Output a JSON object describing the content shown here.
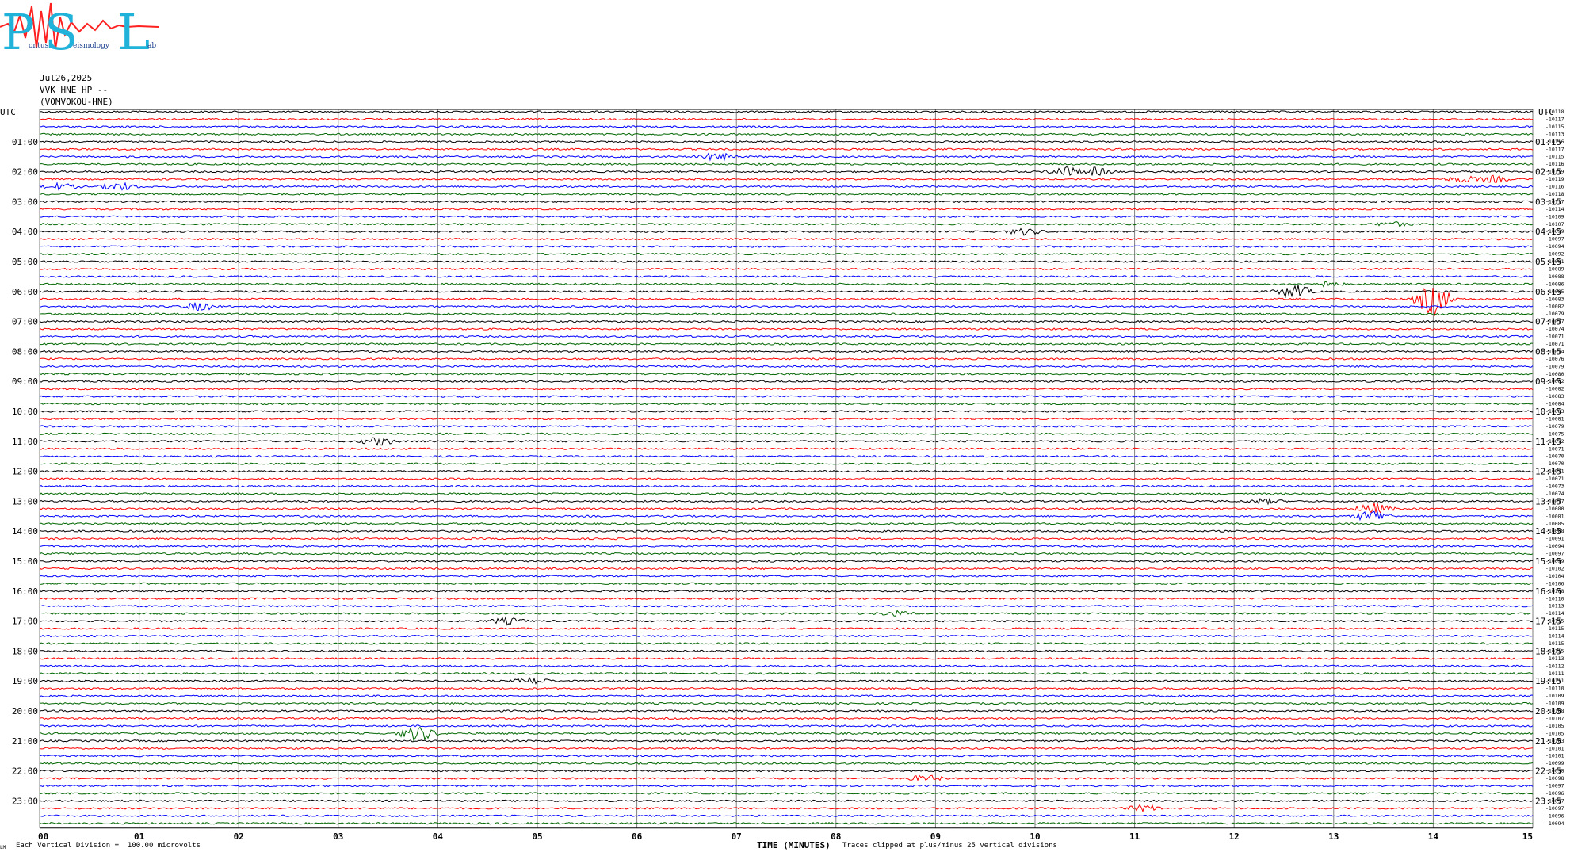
{
  "header": {
    "logo_letters": [
      "P",
      "S",
      "L"
    ],
    "logo_words": [
      "Pontus",
      "Seismology",
      "Lab"
    ],
    "date": "Jul26,2025",
    "station": "VVK HNE HP --",
    "channel": "(VOMVOKOU-HNE)"
  },
  "colors": {
    "trace_cycle": [
      "#000000",
      "#ff0000",
      "#0000ff",
      "#006600"
    ],
    "grid": "#808080",
    "logo_blue": "#20b2d8",
    "logo_red": "#ff2020"
  },
  "footer": {
    "xlabel": "TIME (MINUTES)",
    "clip_note": "Traces clipped at plus/minus 25 vertical divisions",
    "vertical_division": "Each Vertical Division =  100.00 microvolts",
    "small_mark": "LM"
  },
  "chart_data": {
    "type": "line",
    "title": "",
    "xlabel": "TIME (MINUTES)",
    "ylabel": "",
    "xlim": [
      0,
      15
    ],
    "x_ticks": [
      "00",
      "01",
      "02",
      "03",
      "04",
      "05",
      "06",
      "07",
      "08",
      "09",
      "10",
      "11",
      "12",
      "13",
      "14",
      "15"
    ],
    "grid": true,
    "traces_count": 96,
    "left_corner_label": "UTC",
    "right_corner_label": "UTC",
    "left_hour_labels": [
      "01:00",
      "02:00",
      "03:00",
      "04:00",
      "05:00",
      "06:00",
      "07:00",
      "08:00",
      "09:00",
      "10:00",
      "11:00",
      "12:00",
      "13:00",
      "14:00",
      "15:00",
      "16:00",
      "17:00",
      "18:00",
      "19:00",
      "20:00",
      "21:00",
      "22:00",
      "23:00"
    ],
    "right_hour_labels": [
      "01:15",
      "02:15",
      "03:15",
      "04:15",
      "05:15",
      "06:15",
      "07:15",
      "08:15",
      "09:15",
      "10:15",
      "11:15",
      "12:15",
      "13:15",
      "14:15",
      "15:15",
      "16:15",
      "17:15",
      "18:15",
      "19:15",
      "20:15",
      "21:15",
      "22:15",
      "23:15"
    ],
    "trace_offsets": [
      "-10118",
      "-10117",
      "-10115",
      "-10113",
      "-10116",
      "-10117",
      "-10115",
      "-10116",
      "-10119",
      "-10119",
      "-10116",
      "-10118",
      "-10117",
      "-10114",
      "-10109",
      "-10107",
      "-10099",
      "-10097",
      "-10094",
      "-10092",
      "-10091",
      "-10089",
      "-10088",
      "-10086",
      "-10085",
      "-10083",
      "-10082",
      "-10079",
      "-10077",
      "-10074",
      "-10071",
      "-10071",
      "-10074",
      "-10076",
      "-10079",
      "-10080",
      "-10082",
      "-10082",
      "-10083",
      "-10084",
      "-10083",
      "-10081",
      "-10079",
      "-10075",
      "-10072",
      "-10071",
      "-10070",
      "-10070",
      "-10071",
      "-10071",
      "-10073",
      "-10074",
      "-10077",
      "-10080",
      "-10081",
      "-10085",
      "-10088",
      "-10091",
      "-10094",
      "-10097",
      "-10099",
      "-10102",
      "-10104",
      "-10106",
      "-10108",
      "-10110",
      "-10113",
      "-10114",
      "-10115",
      "-10115",
      "-10114",
      "-10115",
      "-10115",
      "-10113",
      "-10112",
      "-10111",
      "-10111",
      "-10110",
      "-10109",
      "-10109",
      "-10108",
      "-10107",
      "-10105",
      "-10105",
      "-10103",
      "-10101",
      "-10101",
      "-10099",
      "-10098",
      "-10098",
      "-10097",
      "-10096",
      "-10097",
      "-10097",
      "-10096",
      "-10094"
    ],
    "events": [
      {
        "trace": 6,
        "minute": 6.8,
        "amp": 5
      },
      {
        "trace": 8,
        "minute": 10.3,
        "amp": 6
      },
      {
        "trace": 8,
        "minute": 10.6,
        "amp": 5
      },
      {
        "trace": 9,
        "minute": 14.3,
        "amp": 4
      },
      {
        "trace": 9,
        "minute": 14.6,
        "amp": 4
      },
      {
        "trace": 10,
        "minute": 0.2,
        "amp": 4
      },
      {
        "trace": 10,
        "minute": 0.8,
        "amp": 5
      },
      {
        "trace": 15,
        "minute": 13.6,
        "amp": 3
      },
      {
        "trace": 16,
        "minute": 9.9,
        "amp": 4
      },
      {
        "trace": 23,
        "minute": 12.9,
        "amp": 3
      },
      {
        "trace": 24,
        "minute": 12.6,
        "amp": 9
      },
      {
        "trace": 25,
        "minute": 14.0,
        "amp": 22
      },
      {
        "trace": 26,
        "minute": 1.6,
        "amp": 5
      },
      {
        "trace": 44,
        "minute": 3.4,
        "amp": 5
      },
      {
        "trace": 52,
        "minute": 12.3,
        "amp": 3
      },
      {
        "trace": 53,
        "minute": 13.4,
        "amp": 7
      },
      {
        "trace": 54,
        "minute": 13.4,
        "amp": 8
      },
      {
        "trace": 67,
        "minute": 8.6,
        "amp": 3
      },
      {
        "trace": 68,
        "minute": 4.7,
        "amp": 4
      },
      {
        "trace": 76,
        "minute": 4.95,
        "amp": 4
      },
      {
        "trace": 83,
        "minute": 3.8,
        "amp": 10
      },
      {
        "trace": 89,
        "minute": 8.9,
        "amp": 4
      },
      {
        "trace": 93,
        "minute": 11.1,
        "amp": 4
      }
    ]
  }
}
